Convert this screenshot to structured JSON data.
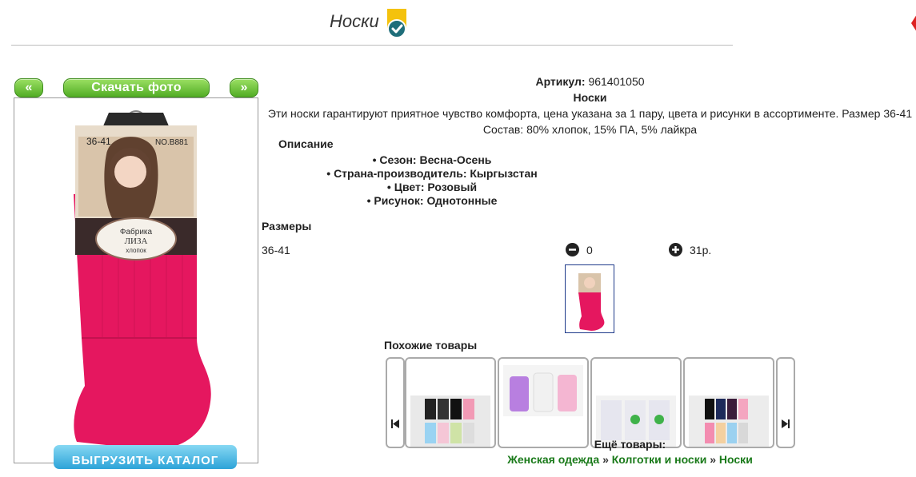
{
  "header": {
    "title": "Носки"
  },
  "photo_panel": {
    "prev_label": "«",
    "next_label": "»",
    "download_label": "Скачать фото",
    "export_label": "ВЫГРУЗИТЬ КАТАЛОГ",
    "photo_texts": {
      "size": "36-41",
      "model": "NO.B881",
      "brand_line1": "Фабрика",
      "brand_line2": "ЛИЗА",
      "brand_line3": "хлопок"
    }
  },
  "product": {
    "sku_label": "Артикул:",
    "sku": "961401050",
    "name": "Носки",
    "description": "Эти носки гарантируют приятное чувство комфорта, цена указана за 1 пару, цвета и рисунки в ассортименте. Размер 36-41 Состав: 80% хлопок, 15% ПА, 5% лайкра",
    "description_heading": "Описание",
    "properties": [
      "Сезон: Весна-Осень",
      "Страна-производитель: Кыргызстан",
      "Цвет: Розовый",
      "Рисунок: Однотонные"
    ]
  },
  "sizes": {
    "heading": "Размеры",
    "rows": [
      {
        "size": "36-41",
        "quantity": "0",
        "price": "31р."
      }
    ]
  },
  "similar": {
    "heading": "Похожие товары"
  },
  "more": {
    "heading": "Ещё товары:",
    "breadcrumb": [
      "Женская одежда",
      "Колготки и носки",
      "Носки"
    ],
    "separator": "»"
  },
  "colors": {
    "accent_green": "#52ad25",
    "sock_pink": "#e5175f",
    "export_blue": "#2ca3d8"
  }
}
